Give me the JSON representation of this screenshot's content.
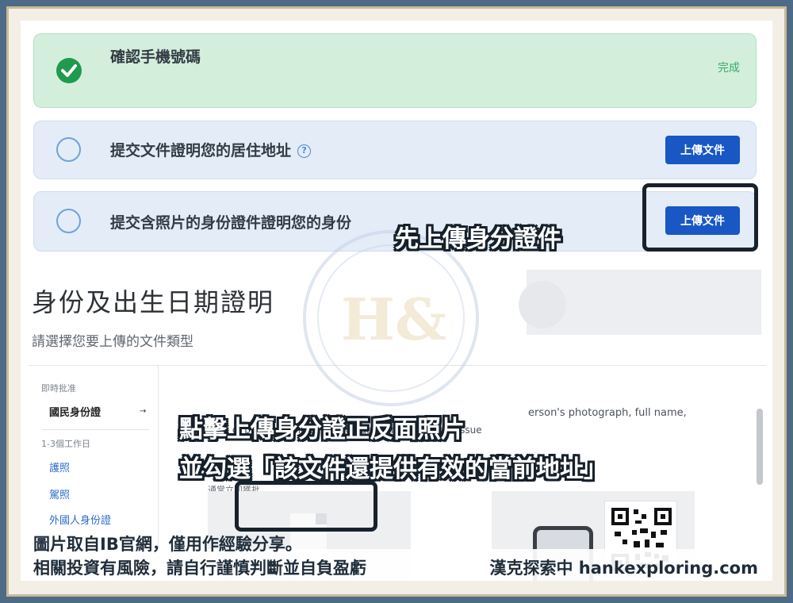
{
  "steps": [
    {
      "title": "確認手機號碼",
      "status": "完成"
    },
    {
      "title": "提交文件證明您的居住地址",
      "help_icon": "help-circle-icon",
      "button": "上傳文件"
    },
    {
      "title": "提交含照片的身份證件證明您的身份",
      "button": "上傳文件"
    }
  ],
  "id_section": {
    "title": "身份及出生日期證明",
    "subtitle": "請選擇您要上傳的文件類型",
    "sidebar": {
      "categories": [
        "即時批准",
        "1-3個工作日"
      ],
      "items": [
        "國民身份證",
        "護照",
        "駕照",
        "外國人身份證"
      ],
      "selected": "國民身份證"
    },
    "description_lines": [
      "erson's photograph, full name,",
      "date of birth and the expiration date and country of issue"
    ],
    "hint": "通常立即獲批"
  },
  "annotations": {
    "upload_id": "先上傳身分證件",
    "instruction_line1": "點擊上傳身分證正反面照片",
    "instruction_line2": "並勾選「該文件還提供有效的當前地址」"
  },
  "footer": {
    "line1": "圖片取自IB官網，僅用作經驗分享。",
    "line2": "相關投資有風險，請自行謹慎判斷並自負盈虧",
    "brand": "漢克探索中 hankexploring.com"
  },
  "colors": {
    "done_bg": "#d3efdc",
    "pending_bg": "#e4ecf8",
    "button": "#1857c4",
    "frame": "#4d6b85"
  }
}
